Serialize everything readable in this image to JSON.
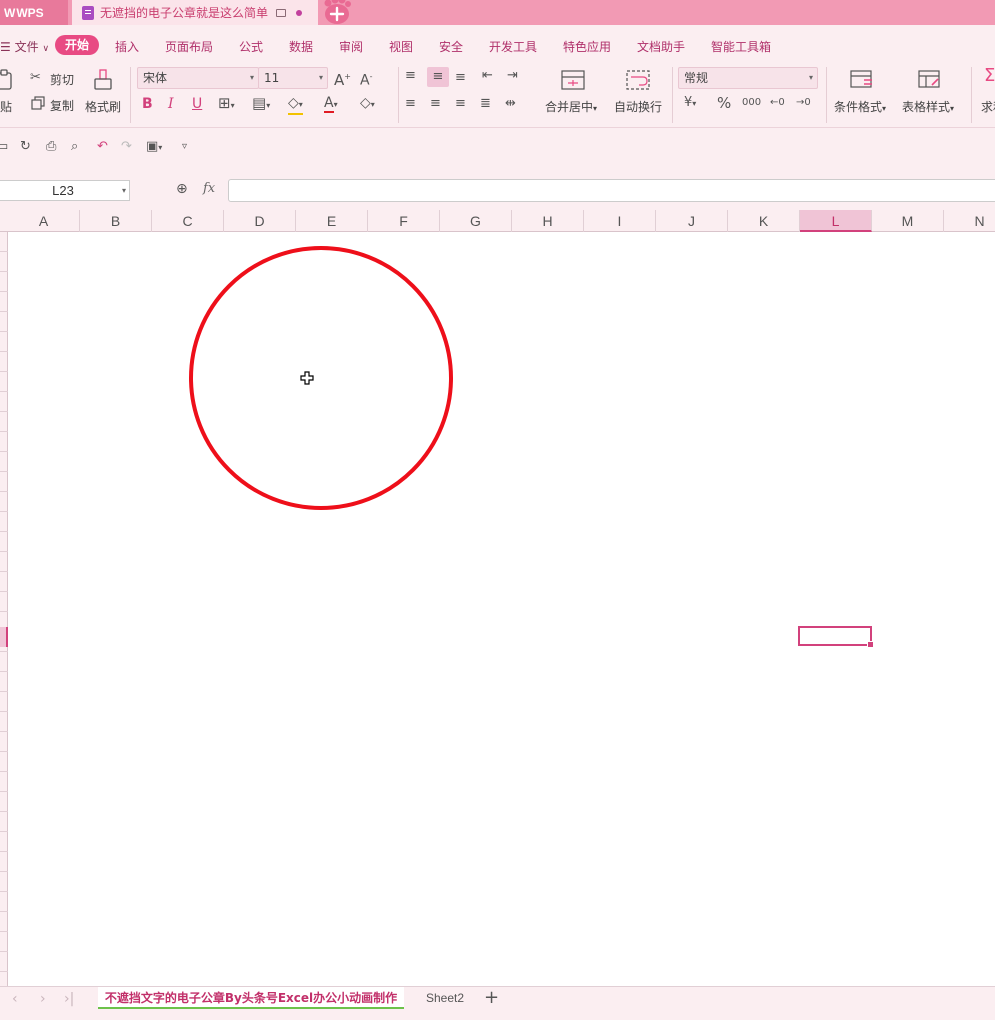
{
  "titlebar": {
    "app_name": "WPS",
    "doc_title": "无遮挡的电子公章就是这么简单"
  },
  "menu": {
    "file": "文件",
    "items": [
      "开始",
      "插入",
      "页面布局",
      "公式",
      "数据",
      "审阅",
      "视图",
      "安全",
      "开发工具",
      "特色应用",
      "文档助手",
      "智能工具箱"
    ]
  },
  "ribbon": {
    "paste": "贴",
    "cut": "剪切",
    "copy": "复制",
    "format_painter": "格式刷",
    "font_name": "宋体",
    "font_size": "11",
    "merge_center": "合并居中",
    "wrap_text": "自动换行",
    "number_format": "常规",
    "conditional_format": "条件格式",
    "table_style": "表格样式",
    "sum": "求和"
  },
  "formula_bar": {
    "cell_ref": "L23",
    "fx_label": "fx",
    "formula": ""
  },
  "columns": [
    "A",
    "B",
    "C",
    "D",
    "E",
    "F",
    "G",
    "H",
    "I",
    "J",
    "K",
    "L",
    "M",
    "N"
  ],
  "active_column": "L",
  "sheets": {
    "active": "不遮挡文字的电子公章By头条号Excel办公小动画制作",
    "other": "Sheet2"
  },
  "colors": {
    "accent": "#e84a83",
    "titlebar": "#f29ab4",
    "ribbon_bg": "#fbeef1",
    "circle": "#ee0f1a"
  }
}
